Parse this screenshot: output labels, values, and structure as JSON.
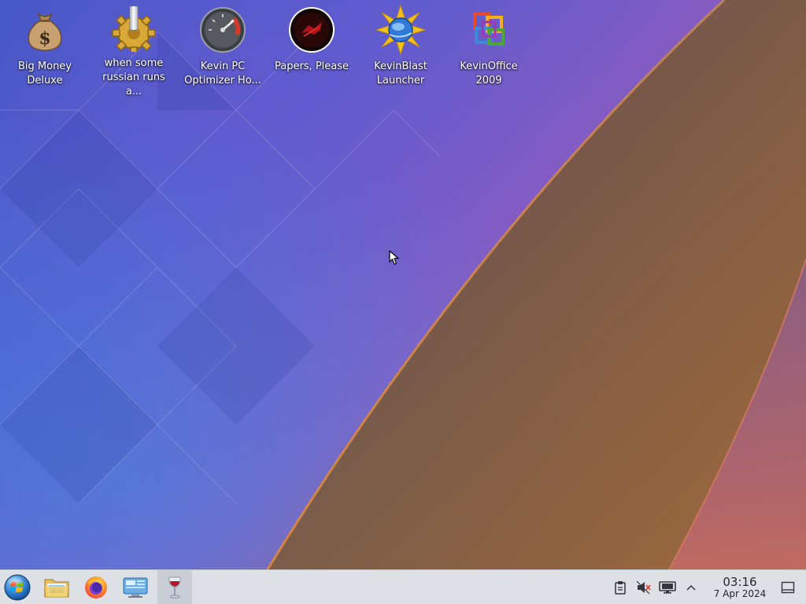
{
  "desktop": {
    "icons": [
      {
        "label": "Big Money\nDeluxe",
        "icon": "money-bag-icon"
      },
      {
        "label": "when some\nrussian runs a...",
        "icon": "gear-icon"
      },
      {
        "label": "Kevin PC\nOptimizer Ho...",
        "icon": "speedometer-icon"
      },
      {
        "label": "Papers, Please",
        "icon": "papers-please-icon"
      },
      {
        "label": "KevinBlast\nLauncher",
        "icon": "blast-launcher-icon"
      },
      {
        "label": "KevinOffice\n2009",
        "icon": "office-icon"
      }
    ]
  },
  "taskbar": {
    "launchers": [
      {
        "name": "start-menu-button",
        "icon": "windows-orb-icon"
      },
      {
        "name": "file-manager-button",
        "icon": "folder-icon"
      },
      {
        "name": "firefox-button",
        "icon": "firefox-icon"
      },
      {
        "name": "remote-desktop-button",
        "icon": "remote-desktop-icon"
      },
      {
        "name": "wine-button",
        "icon": "wine-glass-icon"
      }
    ],
    "tray": {
      "clipboard_icon": "clipboard-icon",
      "volume_icon": "volume-muted-icon",
      "display_icon": "display-icon",
      "expand_icon": "chevron-up-icon"
    },
    "clock": {
      "time": "03:16",
      "date": "7 Apr 2024"
    },
    "show_desktop_icon": "show-desktop-icon"
  },
  "colors": {
    "taskbar_bg": "#dde1e6",
    "label_text": "#ffffff",
    "clock_text": "#232629"
  }
}
